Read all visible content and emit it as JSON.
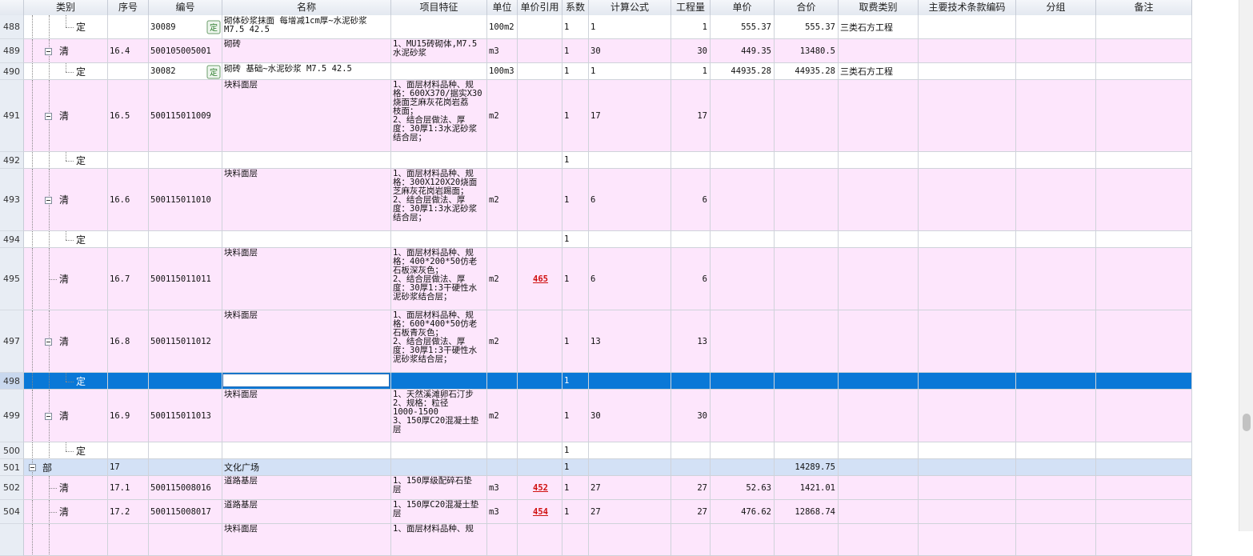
{
  "columns": [
    "类别",
    "序号",
    "编号",
    "名称",
    "项目特征",
    "单位",
    "单价引用",
    "系数",
    "计算公式",
    "工程量",
    "单价",
    "合价",
    "取费类别",
    "主要技术条款编码",
    "分组",
    "备注"
  ],
  "rows": [
    {
      "rn": "488",
      "type": "定",
      "seq": "",
      "code": "30089",
      "name": "砌体砂浆抹面 每增减1cm厚~水泥砂浆\nM7.5 42.5",
      "feat": "",
      "unit": "100m2",
      "ref": "",
      "coef": "1",
      "formula": "1",
      "qty": "1",
      "price": "555.37",
      "total": "555.37",
      "fee": "三类石方工程"
    },
    {
      "rn": "489",
      "type": "清",
      "seq": "16.4",
      "code": "500105005001",
      "name": "砌砖",
      "feat": "1、MU15砖砌体,M7.5\n水泥砂浆",
      "unit": "m3",
      "ref": "",
      "coef": "1",
      "formula": "30",
      "qty": "30",
      "price": "449.35",
      "total": "13480.5",
      "fee": ""
    },
    {
      "rn": "490",
      "type": "定",
      "seq": "",
      "code": "30082",
      "name": "砌砖 基础~水泥砂浆 M7.5 42.5",
      "feat": "",
      "unit": "100m3",
      "ref": "",
      "coef": "1",
      "formula": "1",
      "qty": "1",
      "price": "44935.28",
      "total": "44935.28",
      "fee": "三类石方工程"
    },
    {
      "rn": "491",
      "type": "清",
      "seq": "16.5",
      "code": "500115011009",
      "name": "块料面层",
      "feat": "1、面层材料品种、规\n格：600X370/据实X30\n烧面芝麻灰花岗岩荔\n枝面；\n2、结合层做法、厚\n度：30厚1:3水泥砂浆\n结合层；",
      "unit": "m2",
      "ref": "",
      "coef": "1",
      "formula": "17",
      "qty": "17",
      "price": "",
      "total": "",
      "fee": ""
    },
    {
      "rn": "492",
      "type": "定",
      "seq": "",
      "code": "",
      "name": "",
      "feat": "",
      "unit": "",
      "ref": "",
      "coef": "1",
      "formula": "",
      "qty": "",
      "price": "",
      "total": "",
      "fee": ""
    },
    {
      "rn": "493",
      "type": "清",
      "seq": "16.6",
      "code": "500115011010",
      "name": "块料面层",
      "feat": "1、面层材料品种、规\n格：300X120X20烧面\n芝麻灰花岗岩踢面；\n2、结合层做法、厚\n度：30厚1:3水泥砂浆\n结合层；",
      "unit": "m2",
      "ref": "",
      "coef": "1",
      "formula": "6",
      "qty": "6",
      "price": "",
      "total": "",
      "fee": ""
    },
    {
      "rn": "494",
      "type": "定",
      "seq": "",
      "code": "",
      "name": "",
      "feat": "",
      "unit": "",
      "ref": "",
      "coef": "1",
      "formula": "",
      "qty": "",
      "price": "",
      "total": "",
      "fee": ""
    },
    {
      "rn": "495",
      "type": "清",
      "seq": "16.7",
      "code": "500115011011",
      "name": "块料面层",
      "feat": "1、面层材料品种、规\n格：400*200*50仿老\n石板深灰色；\n2、结合层做法、厚\n度：30厚1:3干硬性水\n泥砂浆结合层；",
      "unit": "m2",
      "ref": "465",
      "coef": "1",
      "formula": "6",
      "qty": "6",
      "price": "",
      "total": "",
      "fee": ""
    },
    {
      "rn": "497",
      "type": "清",
      "seq": "16.8",
      "code": "500115011012",
      "name": "块料面层",
      "feat": "1、面层材料品种、规\n格：600*400*50仿老\n石板青灰色；\n2、结合层做法、厚\n度：30厚1:3干硬性水\n泥砂浆结合层；",
      "unit": "m2",
      "ref": "",
      "coef": "1",
      "formula": "13",
      "qty": "13",
      "price": "",
      "total": "",
      "fee": ""
    },
    {
      "rn": "498",
      "type": "定",
      "seq": "",
      "code": "",
      "name": "",
      "feat": "",
      "unit": "",
      "ref": "",
      "coef": "1",
      "formula": "",
      "qty": "",
      "price": "",
      "total": "",
      "fee": ""
    },
    {
      "rn": "499",
      "type": "清",
      "seq": "16.9",
      "code": "500115011013",
      "name": "块料面层",
      "feat": "1、天然溪滩卵石汀步\n2、规格：粒径\n1000-1500\n3、150厚C20混凝土垫\n层",
      "unit": "m2",
      "ref": "",
      "coef": "1",
      "formula": "30",
      "qty": "30",
      "price": "",
      "total": "",
      "fee": ""
    },
    {
      "rn": "500",
      "type": "定",
      "seq": "",
      "code": "",
      "name": "",
      "feat": "",
      "unit": "",
      "ref": "",
      "coef": "1",
      "formula": "",
      "qty": "",
      "price": "",
      "total": "",
      "fee": ""
    },
    {
      "rn": "501",
      "type": "部",
      "seq": "17",
      "code": "",
      "name": "文化广场",
      "feat": "",
      "unit": "",
      "ref": "",
      "coef": "1",
      "formula": "",
      "qty": "",
      "price": "",
      "total": "14289.75",
      "fee": ""
    },
    {
      "rn": "502",
      "type": "清",
      "seq": "17.1",
      "code": "500115008016",
      "name": "道路基层",
      "feat": "1、150厚级配碎石垫\n层",
      "unit": "m3",
      "ref": "452",
      "coef": "1",
      "formula": "27",
      "qty": "27",
      "price": "52.63",
      "total": "1421.01",
      "fee": ""
    },
    {
      "rn": "504",
      "type": "清",
      "seq": "17.2",
      "code": "500115008017",
      "name": "道路基层",
      "feat": "1、150厚C20混凝土垫\n层",
      "unit": "m3",
      "ref": "454",
      "coef": "1",
      "formula": "27",
      "qty": "27",
      "price": "476.62",
      "total": "12868.74",
      "fee": ""
    },
    {
      "rn": "",
      "type": "",
      "seq": "",
      "code": "",
      "name": "块料面层",
      "feat": "1、面层材料品种、规",
      "unit": "",
      "ref": "",
      "coef": "",
      "formula": "",
      "qty": "",
      "price": "",
      "total": "",
      "fee": ""
    }
  ],
  "icons": {
    "quota": "quota-lookup-icon",
    "expander": "collapse-icon"
  },
  "colors": {
    "selected": "#0a78d7",
    "bill_row": "#fde6fc",
    "division_row": "#d3e1f6",
    "link": "#d01010"
  }
}
